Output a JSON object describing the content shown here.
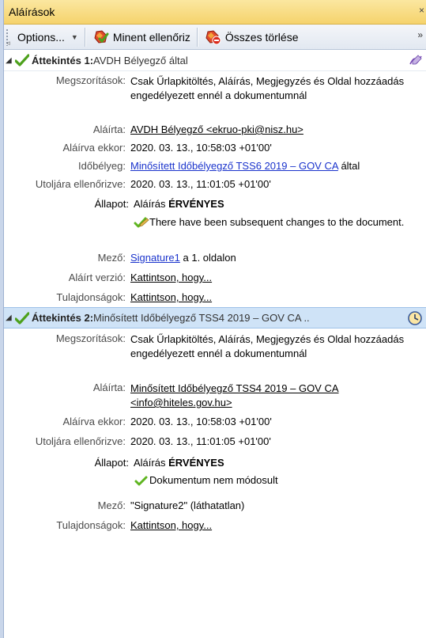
{
  "titlebar": {
    "title": "Aláírások",
    "close": "×"
  },
  "toolbar": {
    "options_label": "Options...",
    "caret": "▼",
    "validate_all_label": "Minent ellenőriz",
    "clear_all_label": "Összes törlése",
    "overflow": "»",
    "corner": "◃"
  },
  "sig1": {
    "header_prefix": "Áttekintés 1:",
    "header_name": "AVDH Bélyegző által",
    "restrictions_label": "Megszorítások:",
    "restrictions_value": "Csak Űrlapkitöltés, Aláírás, Megjegyzés és Oldal hozzáadás engedélyezett ennél a dokumentumnál",
    "signed_by_label": "Aláírta:",
    "signed_by_value": "AVDH Bélyegző <ekruo-pki@nisz.hu>",
    "signed_at_label": "Aláírva ekkor:",
    "signed_at_value": "2020. 03. 13., 10:58:03 +01'00'",
    "timestamp_label": "Időbélyeg:",
    "timestamp_link": "Minősített Időbélyegző TSS6 2019 – GOV CA",
    "timestamp_suffix": "által",
    "last_checked_label": "Utoljára ellenőrizve:",
    "last_checked_value": "2020. 03. 13., 11:01:05 +01'00'",
    "status_label": "Állapot:",
    "status_prefix": "Aláírás ",
    "status_value": "ÉRVÉNYES",
    "status_note": "There have been subsequent changes to the document.",
    "field_label": "Mező:",
    "field_link": "Signature1",
    "field_suffix": " a 1. oldalon",
    "signed_version_label": "Aláírt verzió:",
    "signed_version_link": "Kattintson, hogy...",
    "properties_label": "Tulajdonságok:",
    "properties_link": "Kattintson, hogy..."
  },
  "sig2": {
    "header_prefix": "Áttekintés 2:",
    "header_name": "Minősített Időbélyegző TSS4 2019 – GOV CA ..",
    "restrictions_label": "Megszorítások:",
    "restrictions_value": "Csak Űrlapkitöltés, Aláírás, Megjegyzés és Oldal hozzáadás engedélyezett ennél a dokumentumnál",
    "signed_by_label": "Aláírta:",
    "signed_by_value": "Minősített Időbélyegző TSS4 2019 – GOV CA <info@hiteles.gov.hu>",
    "signed_at_label": "Aláírva ekkor:",
    "signed_at_value": "2020. 03. 13., 10:58:03 +01'00'",
    "last_checked_label": "Utoljára ellenőrizve:",
    "last_checked_value": "2020. 03. 13., 11:01:05 +01'00'",
    "status_label": "Állapot:",
    "status_prefix": "Aláírás ",
    "status_value": "ÉRVÉNYES",
    "status_note": "Dokumentum nem módosult",
    "field_label": "Mező:",
    "field_value": "\"Signature2\" (láthatatlan)",
    "properties_label": "Tulajdonságok:",
    "properties_link": "Kattintson, hogy..."
  },
  "tree": {
    "expanded_glyph": "◢"
  },
  "colors": {
    "link": "#1a33cc",
    "check_green": "#5fb521",
    "header_bg": "#f5d36c",
    "selected_bg": "#cfe3f7"
  }
}
